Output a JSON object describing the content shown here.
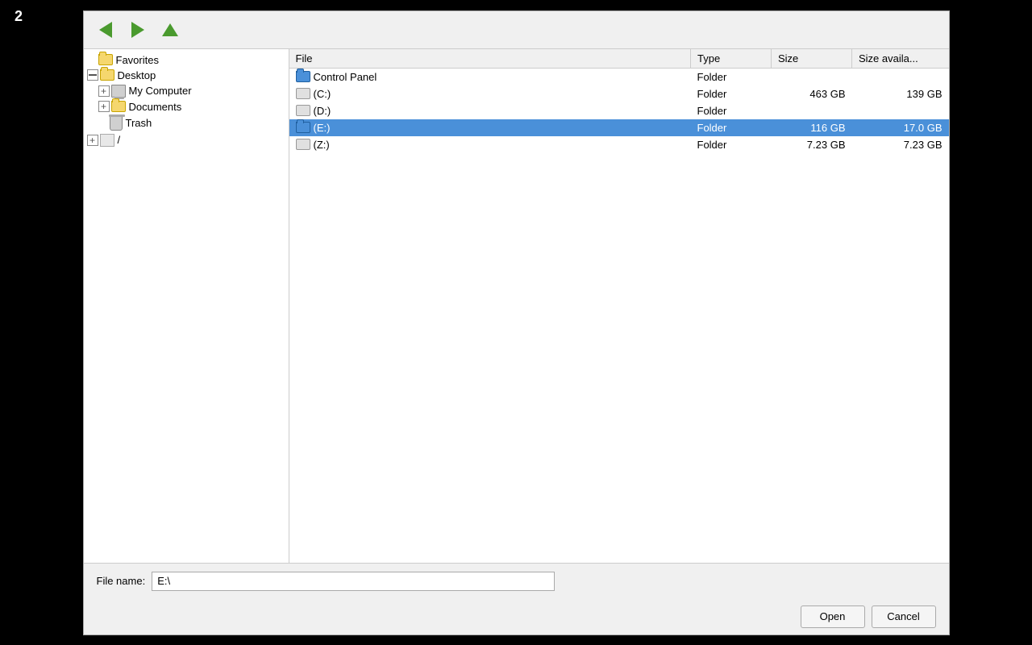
{
  "page": {
    "number": "2"
  },
  "toolbar": {
    "back_label": "",
    "forward_label": "",
    "up_label": ""
  },
  "sidebar": {
    "items": [
      {
        "id": "favorites",
        "label": "Favorites",
        "indent": 0,
        "expand": false,
        "icon": "folder"
      },
      {
        "id": "desktop",
        "label": "Desktop",
        "indent": 0,
        "expand": true,
        "icon": "folder",
        "expanded": true
      },
      {
        "id": "my-computer",
        "label": "My Computer",
        "indent": 1,
        "expand": true,
        "icon": "computer"
      },
      {
        "id": "documents",
        "label": "Documents",
        "indent": 1,
        "expand": true,
        "icon": "folder"
      },
      {
        "id": "trash",
        "label": "Trash",
        "indent": 1,
        "expand": false,
        "icon": "trash"
      },
      {
        "id": "slash",
        "label": "/",
        "indent": 0,
        "expand": true,
        "icon": "generic"
      }
    ]
  },
  "file_table": {
    "headers": [
      {
        "id": "file",
        "label": "File"
      },
      {
        "id": "type",
        "label": "Type"
      },
      {
        "id": "size",
        "label": "Size"
      },
      {
        "id": "avail",
        "label": "Size availa..."
      }
    ],
    "rows": [
      {
        "id": "control-panel",
        "name": "Control Panel",
        "icon": "folder-blue",
        "type": "Folder",
        "size": "",
        "avail": "",
        "selected": false
      },
      {
        "id": "c-drive",
        "name": "(C:)",
        "icon": "drive-gray",
        "type": "Folder",
        "size": "463 GB",
        "avail": "139 GB",
        "selected": false
      },
      {
        "id": "d-drive",
        "name": "(D:)",
        "icon": "drive-gray",
        "type": "Folder",
        "size": "",
        "avail": "",
        "selected": false
      },
      {
        "id": "e-drive",
        "name": "(E:)",
        "icon": "folder-blue",
        "type": "Folder",
        "size": "116 GB",
        "avail": "17.0 GB",
        "selected": true
      },
      {
        "id": "z-drive",
        "name": "(Z:)",
        "icon": "drive-gray",
        "type": "Folder",
        "size": "7.23 GB",
        "avail": "7.23 GB",
        "selected": false
      }
    ]
  },
  "bottom": {
    "filename_label": "File name:",
    "filename_value": "E:\\"
  },
  "buttons": {
    "open_label": "Open",
    "cancel_label": "Cancel"
  }
}
